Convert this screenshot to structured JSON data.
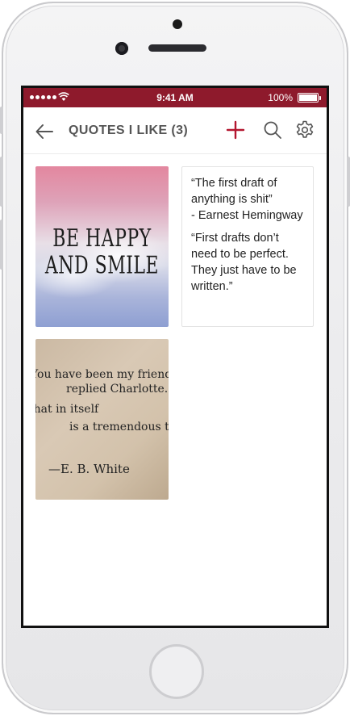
{
  "status_bar": {
    "time": "9:41 AM",
    "battery": "100%",
    "background": "#8e1a2c"
  },
  "nav": {
    "title": "QUOTES I LIKE (3)",
    "back_icon": "back-arrow-icon",
    "add_icon": "plus-icon",
    "search_icon": "search-icon",
    "settings_icon": "gear-icon",
    "accent": "#b3162f"
  },
  "cards": [
    {
      "type": "image",
      "image_text": "BE HAPPY AND SMILE"
    },
    {
      "type": "text",
      "quote1": "“The first draft of anything is shit”",
      "author1": "- Earnest Hemingway",
      "quote2": "“First drafts don’t need to be perfect. They just have to be written.”"
    },
    {
      "type": "image",
      "lines": [
        "You have been my friend,”",
        "replied Charlotte.",
        "that in itself",
        "is a tremendous thing",
        "—E. B. White"
      ]
    }
  ]
}
